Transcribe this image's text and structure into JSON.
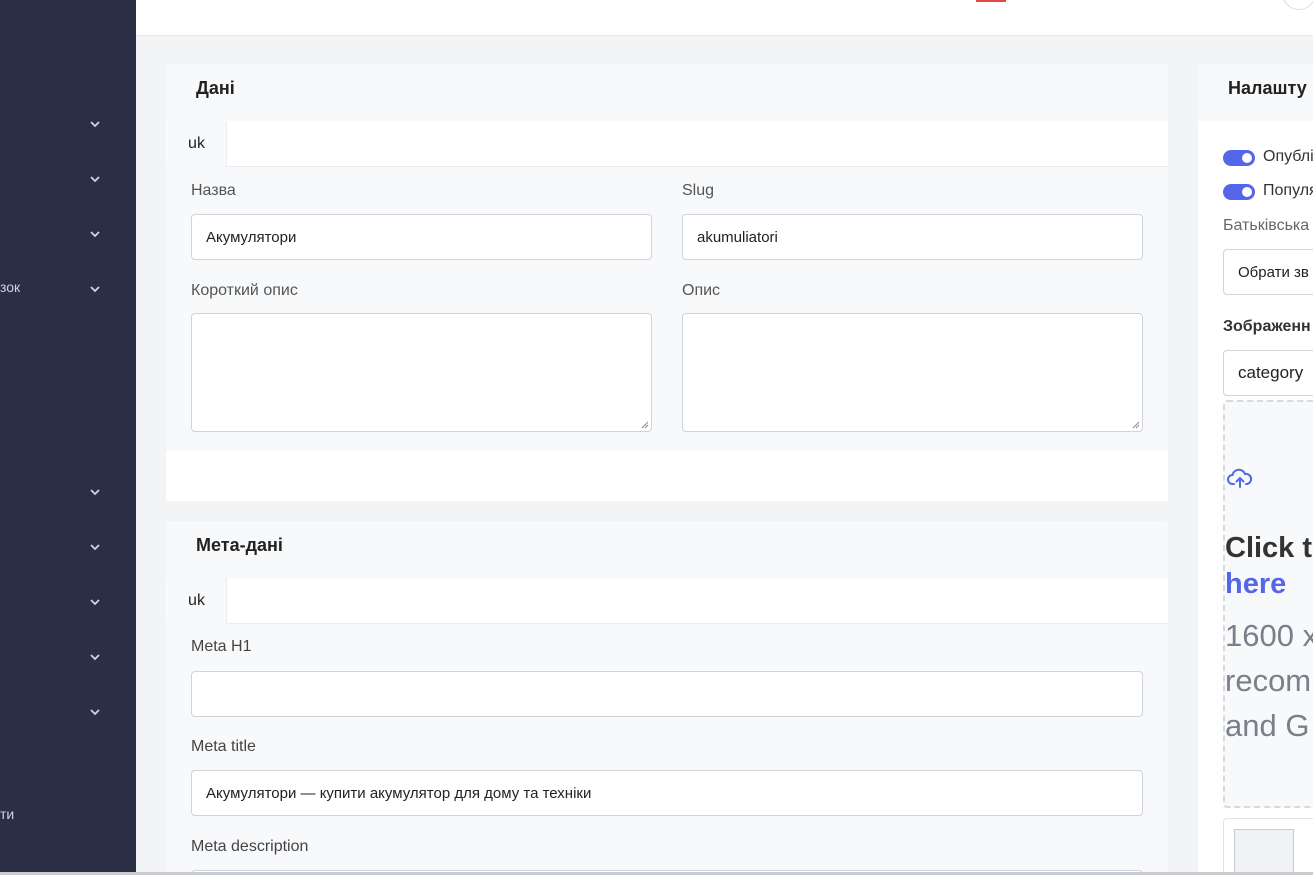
{
  "sidebar": {
    "partial_label_1": "зок",
    "partial_label_2": "ти"
  },
  "data_card": {
    "title": "Дані",
    "tab": "uk",
    "name_label": "Назва",
    "name_value": "Акумулятори",
    "slug_label": "Slug",
    "slug_value": "akumuliatori",
    "short_desc_label": "Короткий опис",
    "desc_label": "Опис"
  },
  "meta_card": {
    "title": "Мета-дані",
    "tab": "uk",
    "h1_label": "Meta H1",
    "h1_value": "",
    "title_label": "Meta title",
    "title_value": "Акумулятори — купити акумулятор для дому та техніки",
    "description_label": "Meta description"
  },
  "settings_card": {
    "title": "Налашту",
    "published_label": "Опублі",
    "popular_label": "Популя",
    "parent_label": "Батьківська",
    "parent_placeholder": "Обрати зв",
    "image_label": "Зображенн",
    "image_value": "category",
    "upload_click": "Click t",
    "upload_here": "here",
    "upload_size": "1600 x",
    "upload_recommend": "recom",
    "upload_formats": "and G"
  },
  "colors": {
    "sidebar": "#2a2f45",
    "accent": "#5566e8",
    "background": "#f3f4f6"
  }
}
